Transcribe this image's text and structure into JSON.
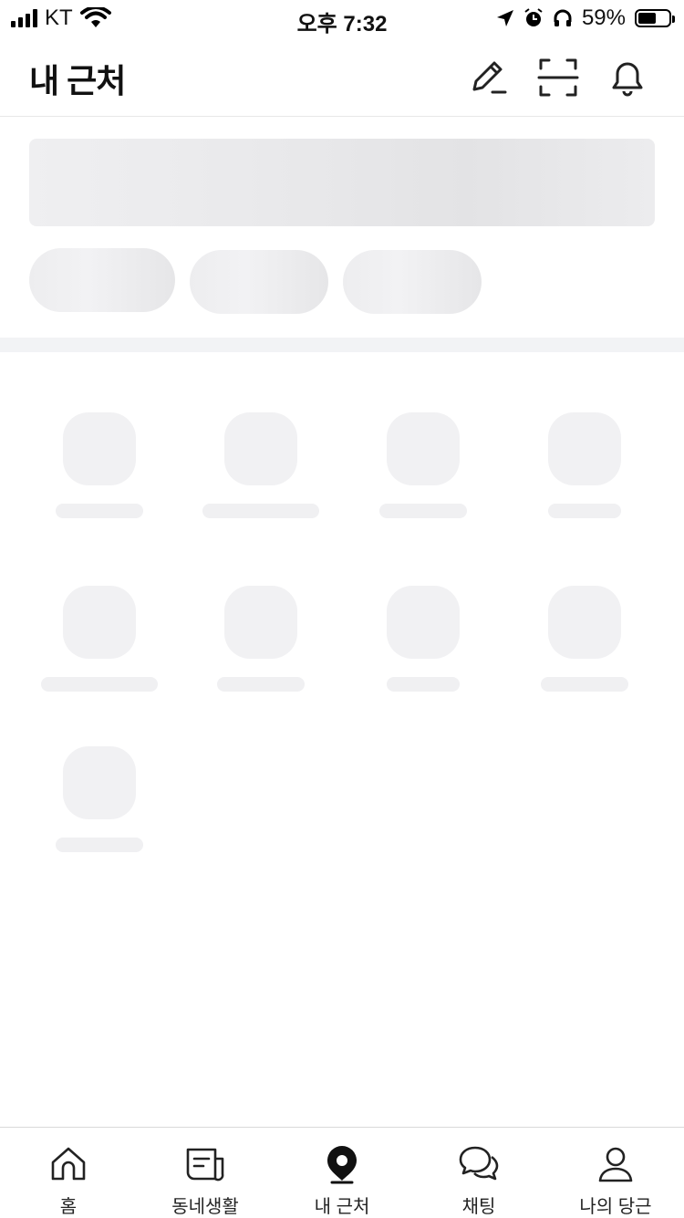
{
  "status_bar": {
    "carrier": "KT",
    "time": "오후 7:32",
    "battery_percent": "59%",
    "battery_level": 0.59,
    "icons": [
      "signal-icon",
      "wifi-icon",
      "location-arrow-icon",
      "alarm-icon",
      "headphones-icon",
      "battery-icon"
    ]
  },
  "header": {
    "title": "내 근처",
    "actions": [
      {
        "name": "edit-icon"
      },
      {
        "name": "scan-icon"
      },
      {
        "name": "bell-icon"
      }
    ]
  },
  "tabbar": {
    "items": [
      {
        "label": "홈",
        "icon": "home-icon",
        "active": false
      },
      {
        "label": "동네생활",
        "icon": "newspaper-icon",
        "active": false
      },
      {
        "label": "내 근처",
        "icon": "location-pin-icon",
        "active": true
      },
      {
        "label": "채팅",
        "icon": "chat-icon",
        "active": false
      },
      {
        "label": "나의 당근",
        "icon": "person-icon",
        "active": false
      }
    ]
  },
  "colors": {
    "text": "#111111",
    "skeleton": "#f1f1f3",
    "divider": "#f2f3f5"
  }
}
